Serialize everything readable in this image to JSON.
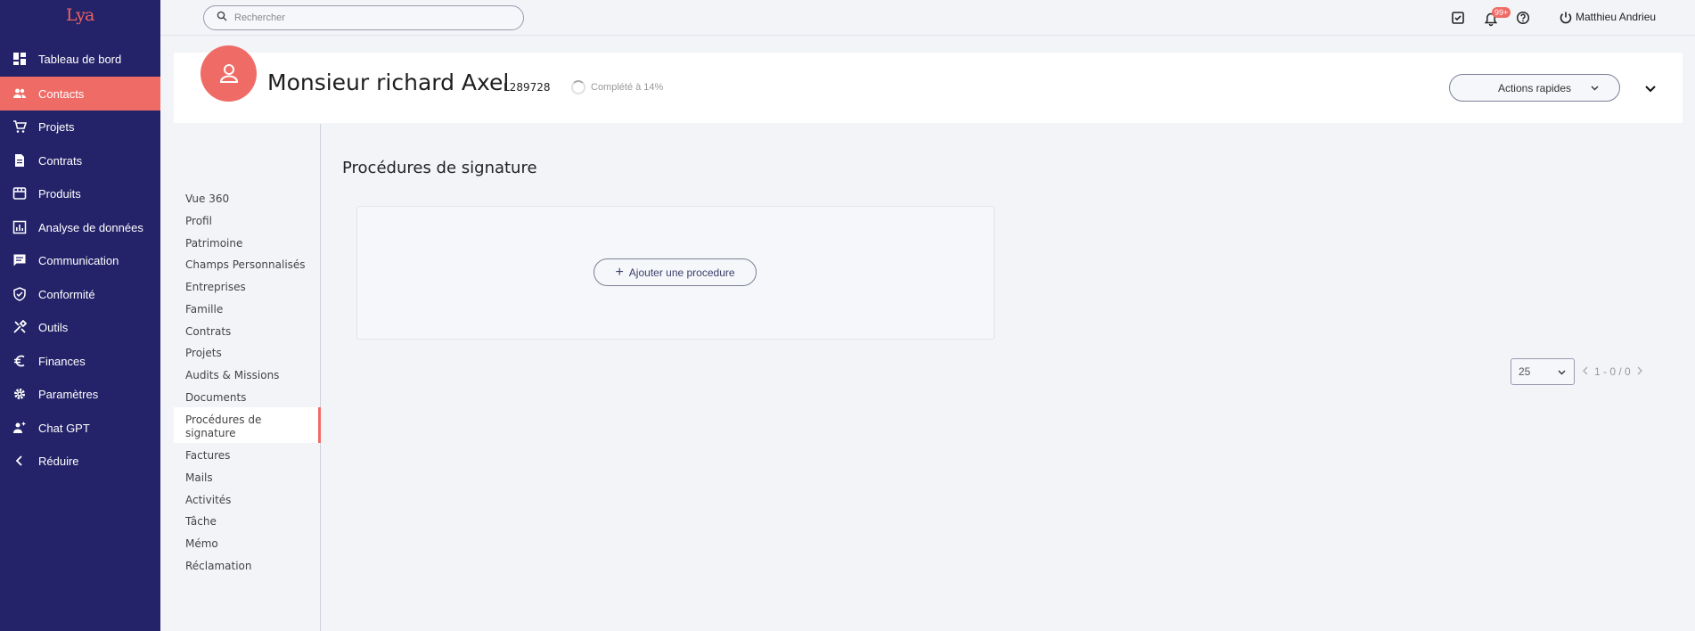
{
  "app": {
    "logo_text": "Lya",
    "brand_color": "#ef6b66",
    "sidebar_color": "#24236a"
  },
  "sidebar": {
    "items": [
      {
        "label": "Tableau de bord",
        "icon": "dashboard-icon"
      },
      {
        "label": "Contacts",
        "icon": "people-icon",
        "active": true
      },
      {
        "label": "Projets",
        "icon": "cart-icon"
      },
      {
        "label": "Contrats",
        "icon": "document-icon"
      },
      {
        "label": "Produits",
        "icon": "store-icon"
      },
      {
        "label": "Analyse de données",
        "icon": "chart-icon"
      },
      {
        "label": "Communication",
        "icon": "message-icon"
      },
      {
        "label": "Conformité",
        "icon": "shield-check-icon"
      },
      {
        "label": "Outils",
        "icon": "tools-icon"
      },
      {
        "label": "Finances",
        "icon": "euro-icon"
      },
      {
        "label": "Paramètres",
        "icon": "gear-icon"
      },
      {
        "label": "Chat GPT",
        "icon": "ai-icon"
      },
      {
        "label": "Réduire",
        "icon": "chevron-left-icon"
      }
    ]
  },
  "topbar": {
    "search_placeholder": "Rechercher",
    "notification_badge": "99+",
    "user_name": "Matthieu Andrieu"
  },
  "contact": {
    "name": "Monsieur richard Axel",
    "id": "L289728",
    "completion": "Complété à 14%",
    "quick_actions_label": "Actions rapides"
  },
  "subnav": {
    "items": [
      "Vue 360",
      "Profil",
      "Patrimoine",
      "Champs Personnalisés",
      "Entreprises",
      "Famille",
      "Contrats",
      "Projets",
      "Audits & Missions",
      "Documents",
      "Procédures de",
      "signature",
      "Factures",
      "Mails",
      "Activités",
      "Tâche",
      "Mémo",
      "Réclamation"
    ]
  },
  "main": {
    "title": "Procédures de signature",
    "add_button_label": "Ajouter une procedure",
    "page_size": "25",
    "pagination_text": "1 - 0 / 0"
  }
}
